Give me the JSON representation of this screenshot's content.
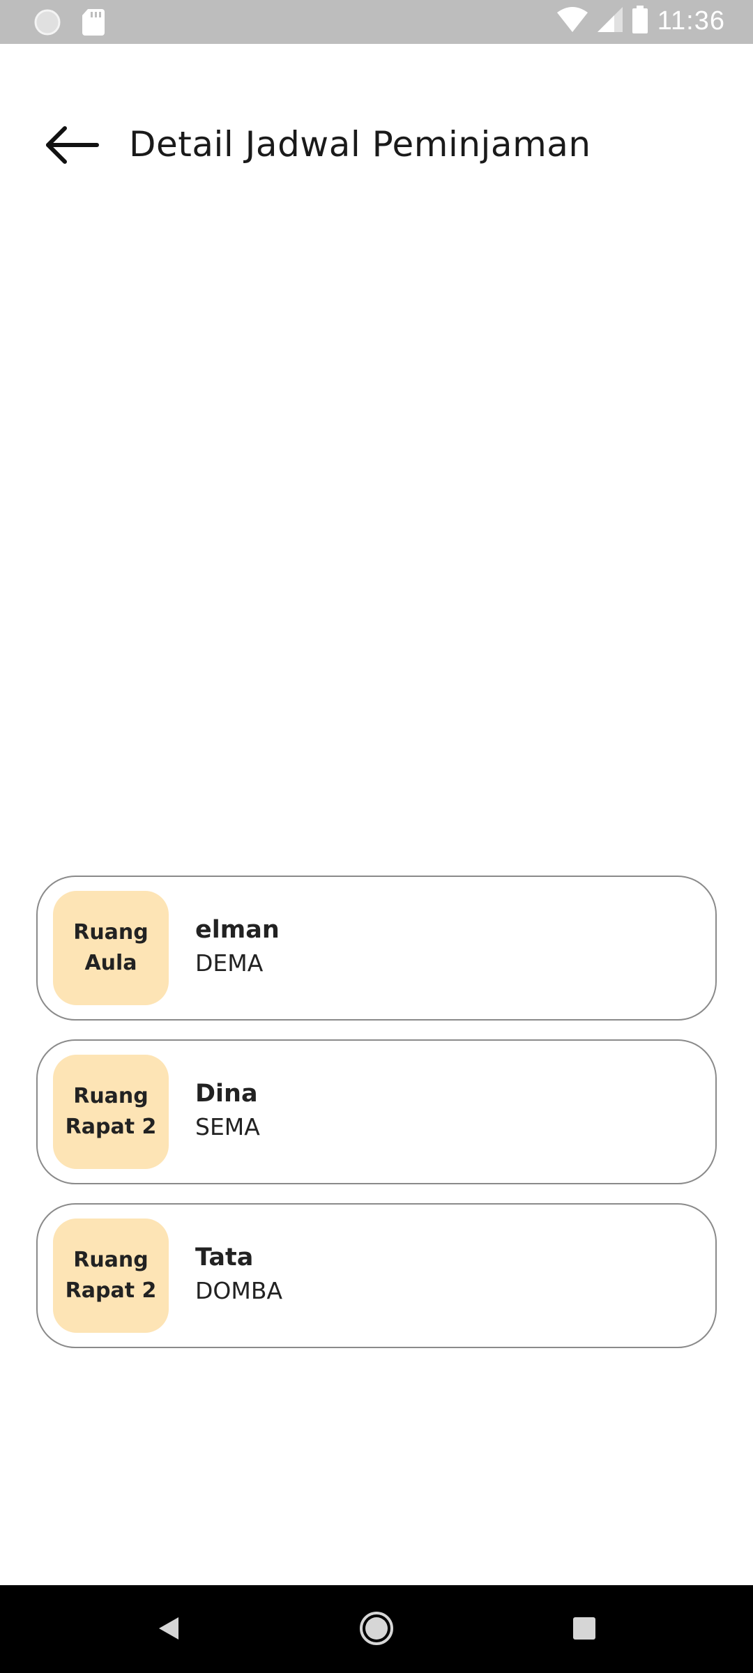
{
  "status_bar": {
    "time": "11:36",
    "icons": [
      "notification-dot-icon",
      "sd-card-icon",
      "wifi-icon",
      "cell-signal-icon",
      "battery-icon"
    ]
  },
  "header": {
    "back_icon": "arrow-left-icon",
    "title": "Detail Jadwal Peminjaman"
  },
  "bookings": [
    {
      "room_line1": "Ruang",
      "room_line2": "Aula",
      "name": "elman",
      "org": "DEMA"
    },
    {
      "room_line1": "Ruang",
      "room_line2": "Rapat 2",
      "name": "Dina",
      "org": "SEMA"
    },
    {
      "room_line1": "Ruang",
      "room_line2": "Rapat 2",
      "name": "Tata",
      "org": "DOMBA"
    }
  ],
  "colors": {
    "badge_bg": "#fde4b5",
    "status_bar_bg": "#bdbdbd",
    "nav_bar_bg": "#000000"
  },
  "nav_bar": {
    "icons": [
      "nav-back-icon",
      "nav-home-icon",
      "nav-recents-icon"
    ]
  }
}
